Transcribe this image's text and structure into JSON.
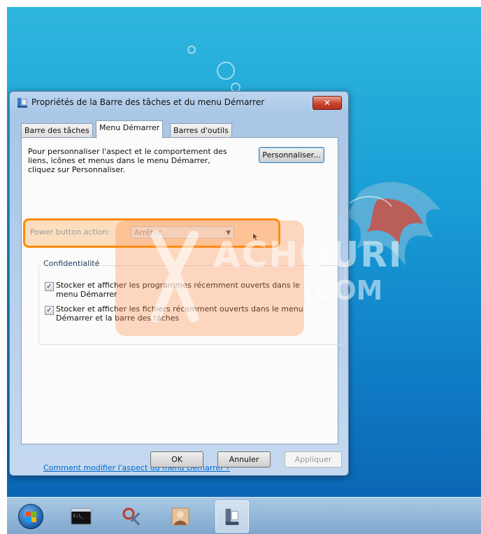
{
  "window": {
    "title": "Propriétés de la Barre des tâches et du menu Démarrer",
    "close_label": "✕"
  },
  "tabs": [
    {
      "label": "Barre des tâches"
    },
    {
      "label": "Menu Démarrer"
    },
    {
      "label": "Barres d'outils"
    }
  ],
  "panel": {
    "description": "Pour personnaliser l'aspect et le comportement des liens, icônes et menus dans le menu Démarrer, cliquez sur Personnaliser.",
    "customize_button": "Personnaliser...",
    "power_label": "Power button action:",
    "power_value": "Arrêter",
    "privacy_group_title": "Confidentialité",
    "checkboxes": [
      {
        "label": "Stocker et afficher les programmes récemment ouverts dans le menu Démarrer",
        "checked": true
      },
      {
        "label": "Stocker et afficher les fichiers récemment ouverts dans le menu Démarrer et la barre des tâches",
        "checked": true
      }
    ],
    "help_link": "Comment modifier l'aspect du menu Démarrer ?"
  },
  "buttons": {
    "ok": "OK",
    "cancel": "Annuler",
    "apply": "Appliquer"
  },
  "watermark": {
    "text": "ACHOURI",
    "sub": ".COM"
  },
  "colors": {
    "highlight": "#ff8a00",
    "desktop_blue": "#1a9fd6",
    "close_red": "#c9452f"
  },
  "taskbar": {
    "items": [
      {
        "icon": "windows-start-orb"
      },
      {
        "icon": "command-prompt-icon"
      },
      {
        "icon": "snipping-tool-icon"
      },
      {
        "icon": "user-picture-icon"
      },
      {
        "icon": "taskbar-properties-icon",
        "active": true
      }
    ]
  }
}
